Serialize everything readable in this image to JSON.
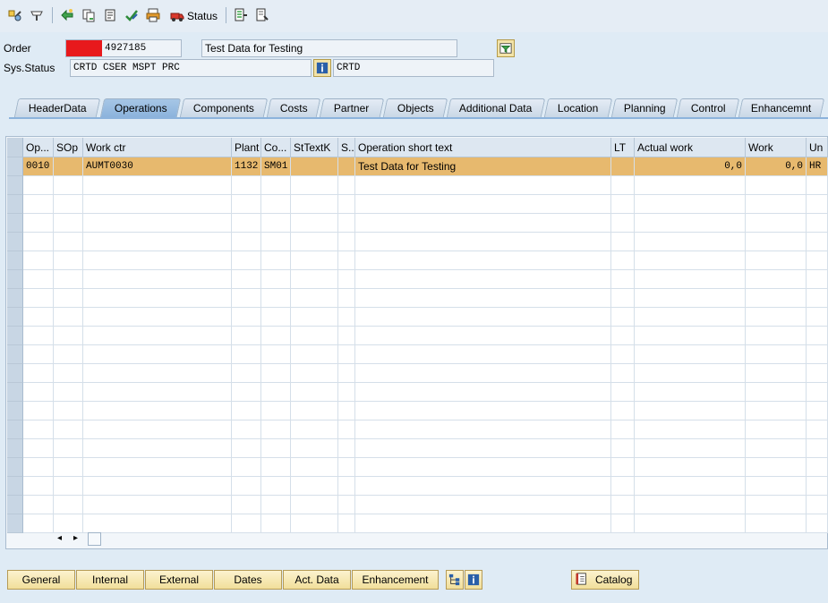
{
  "toolbar": {
    "icons": [
      "change-display-icon",
      "edit-icon",
      "release-icon",
      "copy-icon",
      "document-icon",
      "check-icon",
      "print-icon",
      "status-icon",
      "object-list-icon",
      "page-icon"
    ],
    "status_label": "Status"
  },
  "header": {
    "order_label": "Order",
    "order_number": "4927185",
    "order_description": "Test Data for Testing",
    "sys_status_label": "Sys.Status",
    "sys_status_value": "CRTD CSER MSPT PRC",
    "user_status_value": "CRTD"
  },
  "tabs": [
    {
      "label": "HeaderData",
      "active": false
    },
    {
      "label": "Operations",
      "active": true
    },
    {
      "label": "Components",
      "active": false
    },
    {
      "label": "Costs",
      "active": false
    },
    {
      "label": "Partner",
      "active": false
    },
    {
      "label": "Objects",
      "active": false
    },
    {
      "label": "Additional Data",
      "active": false
    },
    {
      "label": "Location",
      "active": false
    },
    {
      "label": "Planning",
      "active": false
    },
    {
      "label": "Control",
      "active": false
    },
    {
      "label": "Enhancemnt",
      "active": false
    }
  ],
  "grid": {
    "columns": [
      "Op...",
      "SOp",
      "Work ctr",
      "Plant",
      "Co...",
      "StTextK",
      "S..",
      "Operation short text",
      "LT",
      "Actual work",
      "Work",
      "Un"
    ],
    "rows": [
      [
        "0010",
        "",
        "AUMT0030",
        "1132",
        "SM01",
        "",
        "",
        "Test Data for Testing",
        "",
        "0,0",
        "0,0",
        "HR"
      ]
    ],
    "empty_row_count": 19
  },
  "bottom_buttons": {
    "general": "General",
    "internal": "Internal",
    "external": "External",
    "dates": "Dates",
    "act_data": "Act. Data",
    "enhancement": "Enhancement",
    "catalog": "Catalog"
  },
  "colors": {
    "background": "#dfebf5",
    "selected_row": "#e7b96e",
    "active_tab": "#8cb3dc",
    "redaction": "#e8191c"
  }
}
